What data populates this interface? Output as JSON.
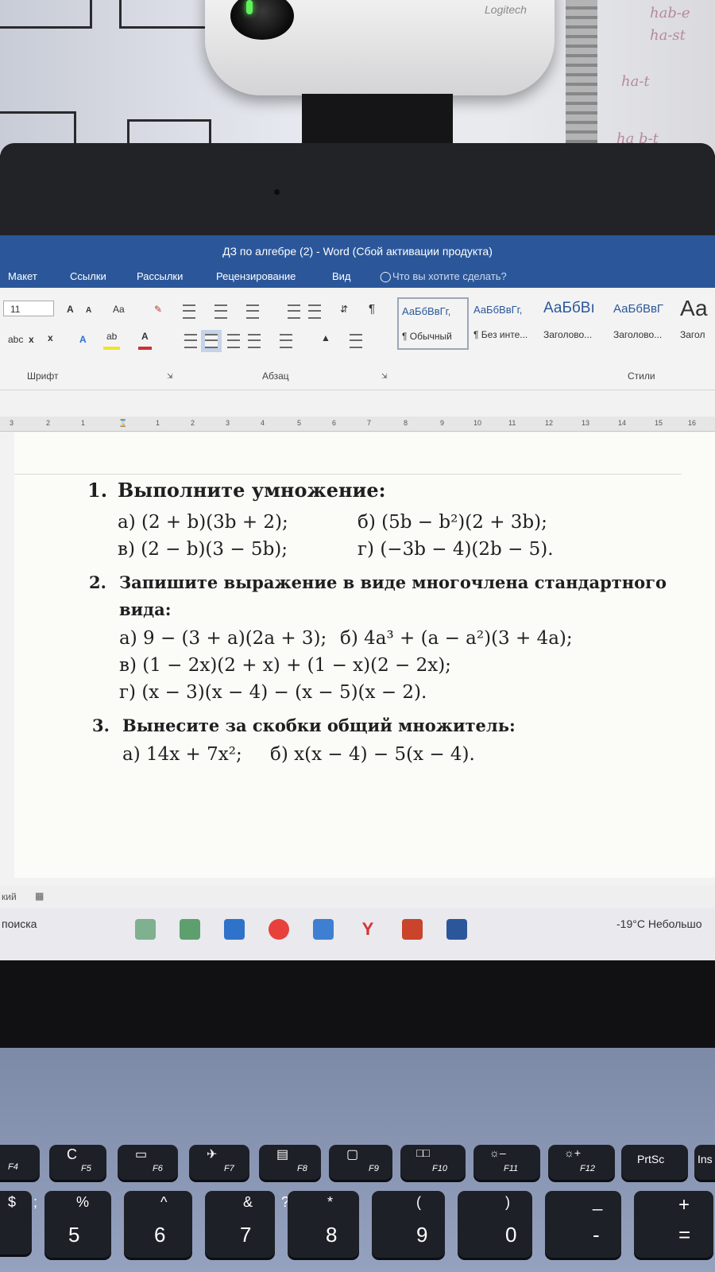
{
  "window": {
    "title": "ДЗ по алгебре (2) - Word (Сбой активации продукта)"
  },
  "ribbon_tabs": [
    "Макет",
    "Ссылки",
    "Рассылки",
    "Рецензирование",
    "Вид"
  ],
  "tell_me": "Что вы хотите сделать?",
  "font_group": {
    "font_size": "11",
    "label": "Шрифт",
    "grow": "A",
    "shrink": "A",
    "case": "Aa",
    "strike": "abc",
    "subscript": "x",
    "superscript": "x",
    "highlight": "ab",
    "color": "A"
  },
  "paragraph_group": {
    "label": "Абзац",
    "pilcrow": "¶"
  },
  "styles_group": {
    "label": "Стили",
    "styles": [
      {
        "preview": "АаБбВвГг,",
        "name": "¶ Обычный"
      },
      {
        "preview": "АаБбВвГг,",
        "name": "¶ Без инте..."
      },
      {
        "preview": "АаБбВı",
        "name": "Заголово..."
      },
      {
        "preview": "АаБбВвГ",
        "name": "Заголово..."
      },
      {
        "preview": "Аа",
        "name": "Загол"
      }
    ]
  },
  "ruler_numbers": [
    "3",
    "2",
    "1",
    "1",
    "2",
    "3",
    "4",
    "5",
    "6",
    "7",
    "8",
    "9",
    "10",
    "11",
    "12",
    "13",
    "14",
    "15",
    "16"
  ],
  "document": {
    "tasks": [
      {
        "number": "1.",
        "text": "Выполните умножение:"
      },
      {
        "number": "2.",
        "text": "Запишите выражение в виде многочлена стандартного"
      },
      {
        "number": "",
        "text": "вида:"
      },
      {
        "number": "3.",
        "text": "Вынесите за скобки общий множитель:"
      }
    ],
    "items": {
      "t1a": "а) (2 + b)(3b + 2);",
      "t1b": "б) (5b − b²)(2 + 3b);",
      "t1v": "в) (2 − b)(3 − 5b);",
      "t1g": "г) (−3b − 4)(2b − 5).",
      "t2a": "а) 9 − (3 + a)(2a + 3);",
      "t2b": "б) 4a³ + (a − a²)(3 + 4a);",
      "t2v": "в) (1 − 2x)(2 + x) + (1 − x)(2 − 2x);",
      "t2g": "г) (x − 3)(x − 4) − (x − 5)(x − 2).",
      "t3a": "а) 14x + 7x²;",
      "t3b": "б) x(x − 4) − 5(x − 4)."
    }
  },
  "statusbar": {
    "lang": "кий"
  },
  "taskbar": {
    "search": "поиска",
    "weather": "-19°C  Небольшо",
    "icons": [
      {
        "name": "calculator-icon",
        "color": "#7fb08f"
      },
      {
        "name": "photos-icon",
        "color": "#5e9f6e"
      },
      {
        "name": "mail-icon",
        "color": "#2e73c9"
      },
      {
        "name": "yandex-icon",
        "color": "#e8413c"
      },
      {
        "name": "app-icon",
        "color": "#3f7fd1"
      },
      {
        "name": "yandex-browser-icon",
        "color": "#d83232"
      },
      {
        "name": "powerpoint-icon",
        "color": "#c9442a"
      },
      {
        "name": "word-icon",
        "color": "#2b579a"
      }
    ]
  },
  "webcam": {
    "brand": "Logitech"
  },
  "handwriting": [
    "hab-e",
    "ha-st",
    "ha-t",
    "ha b-t"
  ],
  "keyboard": {
    "fn_row": [
      "F4",
      "F5",
      "F6",
      "F7",
      "F8",
      "F9",
      "F10",
      "F11",
      "F12",
      "PrtSc",
      "Ins"
    ],
    "number_row": [
      {
        "top": "$",
        "main": ""
      },
      {
        "top": ";",
        "main": ""
      },
      {
        "top": "%",
        "main": "5"
      },
      {
        "top": "^",
        "main": "6"
      },
      {
        "top": ":",
        "main": ""
      },
      {
        "top": "&",
        "main": "7"
      },
      {
        "top": "?",
        "main": ""
      },
      {
        "top": "*",
        "main": "8"
      },
      {
        "top": "(",
        "main": "9"
      },
      {
        "top": ")",
        "main": "0"
      },
      {
        "top": "_",
        "main": "-"
      },
      {
        "top": "+",
        "main": "="
      }
    ]
  }
}
